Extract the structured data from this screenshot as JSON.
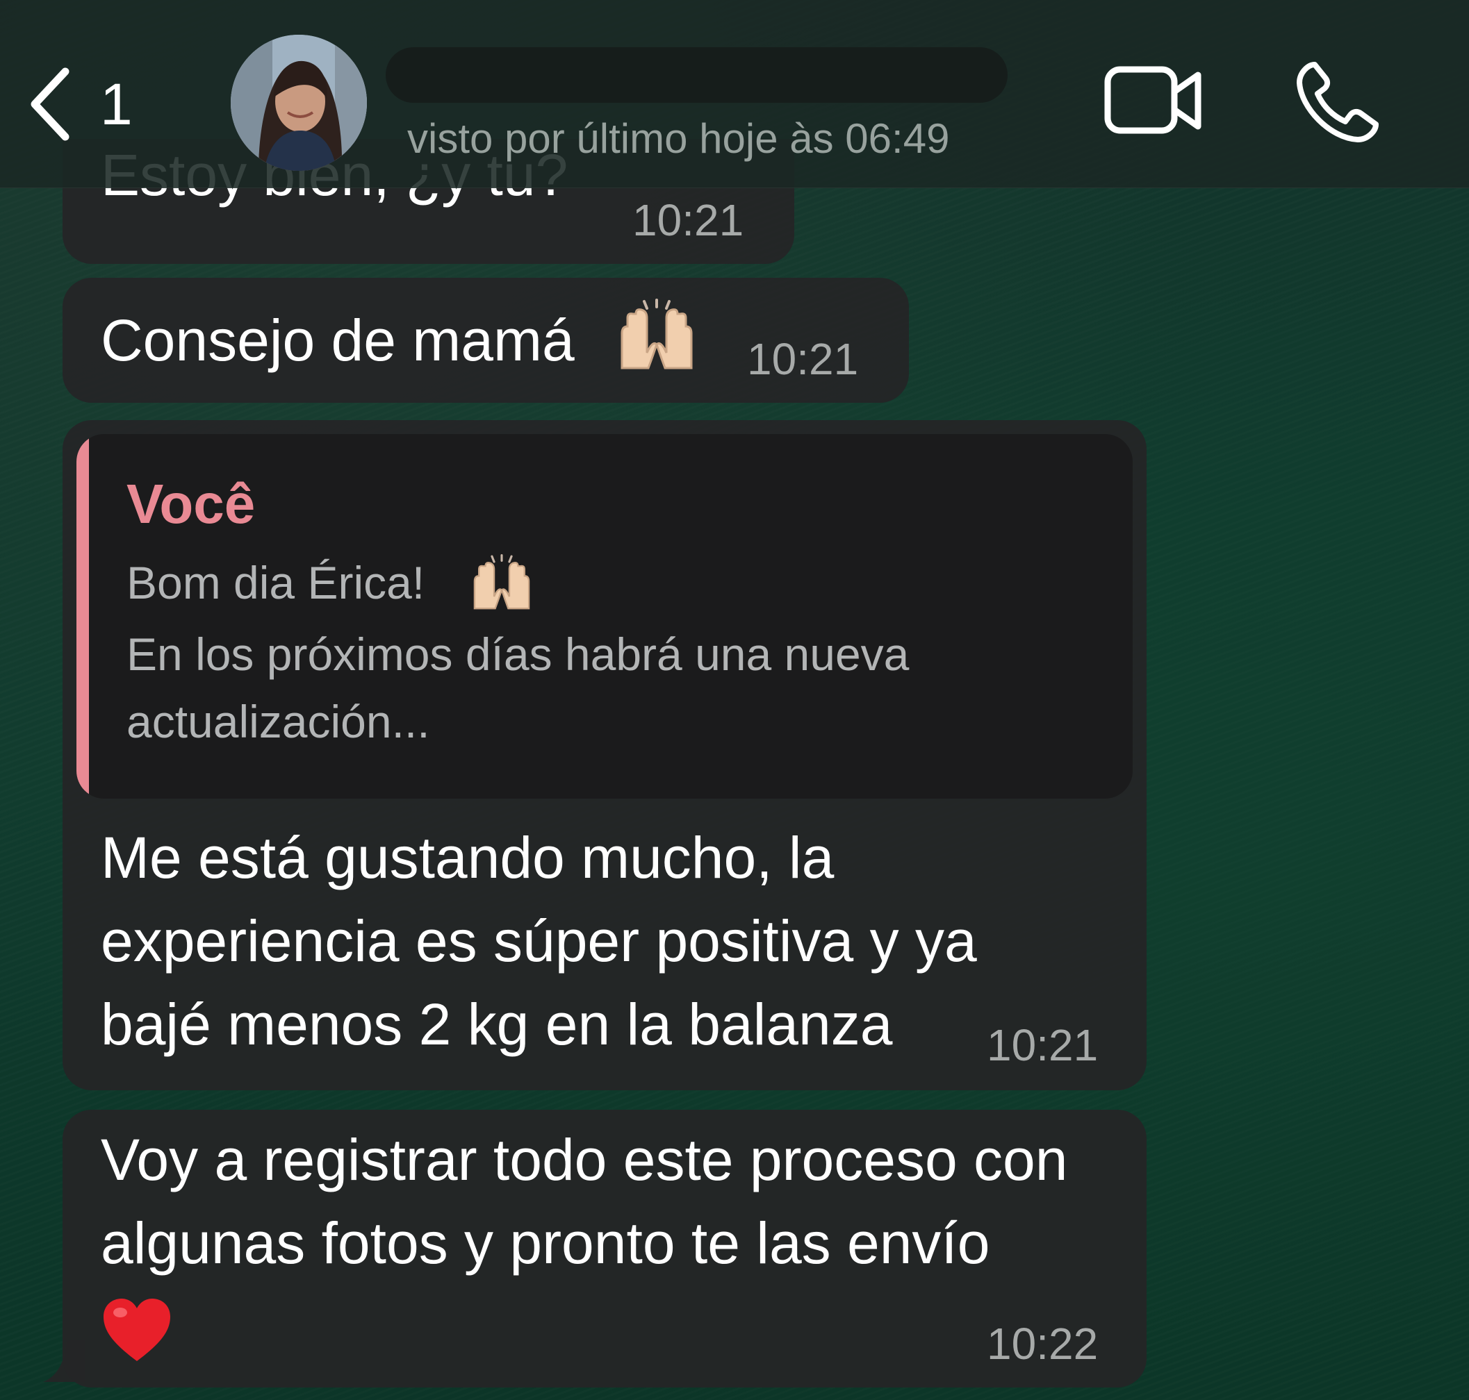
{
  "header": {
    "back_count": "1",
    "last_seen": "visto por último hoje às 06:49",
    "icons": {
      "back": "chevron-left-icon",
      "video": "video-camera-icon",
      "call": "phone-icon"
    }
  },
  "messages": [
    {
      "text": "Estoy bien, ¿y tu?",
      "time": "10:21"
    },
    {
      "text": "Consejo de mamá",
      "emoji": "raised-hands",
      "time": "10:21"
    },
    {
      "reply": {
        "author": "Você",
        "line1": "Bom dia Érica!",
        "line1_emoji": "raised-hands",
        "line2": "En los próximos días habrá una nueva",
        "line3": "actualización..."
      },
      "lines": [
        "Me está gustando mucho, la",
        "experiencia es súper positiva y ya",
        "bajé menos 2 kg en la balanza"
      ],
      "time": "10:21"
    },
    {
      "lines": [
        "Voy a registrar todo este proceso con",
        "algunas fotos y pronto te las envío"
      ],
      "emoji": "red-heart",
      "time": "10:22"
    }
  ],
  "colors": {
    "bubble": "#242526",
    "reply_accent": "#e98a94",
    "timestamp": "#a7aaa9",
    "header": "#1a2824"
  }
}
